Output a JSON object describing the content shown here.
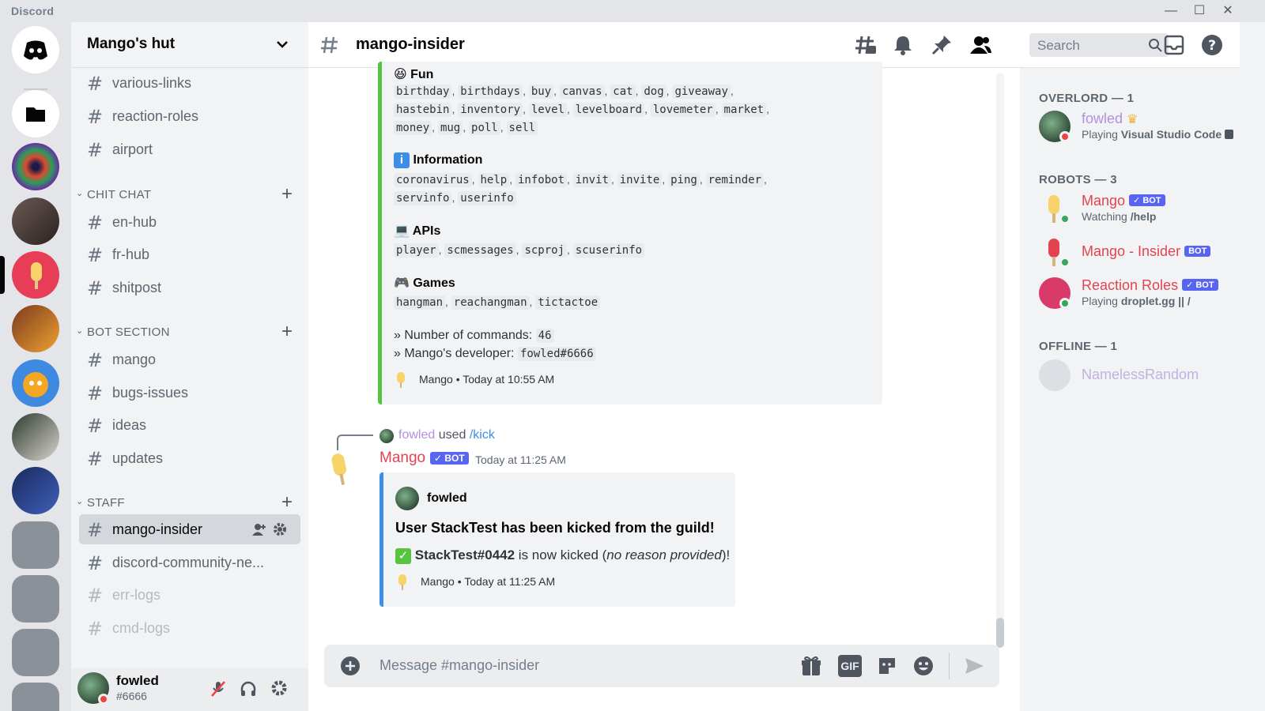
{
  "window": {
    "brand": "Discord"
  },
  "server": {
    "name": "Mango's hut"
  },
  "channels_top": [
    {
      "label": "various-links"
    },
    {
      "label": "reaction-roles"
    },
    {
      "label": "airport"
    }
  ],
  "categories": {
    "chit_chat": {
      "label": "CHIT CHAT",
      "channels": [
        {
          "label": "en-hub"
        },
        {
          "label": "fr-hub"
        },
        {
          "label": "shitpost"
        }
      ]
    },
    "bot_section": {
      "label": "BOT SECTION",
      "channels": [
        {
          "label": "mango"
        },
        {
          "label": "bugs-issues"
        },
        {
          "label": "ideas"
        },
        {
          "label": "updates"
        }
      ]
    },
    "staff": {
      "label": "STAFF",
      "channels": [
        {
          "label": "mango-insider"
        },
        {
          "label": "discord-community-ne..."
        },
        {
          "label": "err-logs"
        },
        {
          "label": "cmd-logs"
        }
      ]
    }
  },
  "user": {
    "name": "fowled",
    "tag": "#6666"
  },
  "chat": {
    "channel": "mango-insider",
    "search_placeholder": "Search",
    "composer_placeholder": "Message #mango-insider",
    "gif_label": "GIF"
  },
  "help_embed": {
    "sections": [
      {
        "title": "Fun",
        "commands": [
          "birthday",
          "birthdays",
          "buy",
          "canvas",
          "cat",
          "dog",
          "giveaway",
          "hastebin",
          "inventory",
          "level",
          "levelboard",
          "lovemeter",
          "market",
          "money",
          "mug",
          "poll",
          "sell"
        ]
      },
      {
        "title": "Information",
        "commands": [
          "coronavirus",
          "help",
          "infobot",
          "invit",
          "invite",
          "ping",
          "reminder",
          "servinfo",
          "userinfo"
        ]
      },
      {
        "title": "APIs",
        "commands": [
          "player",
          "scmessages",
          "scproj",
          "scuserinfo"
        ]
      },
      {
        "title": "Games",
        "commands": [
          "hangman",
          "reachangman",
          "tictactoe"
        ]
      }
    ],
    "count_label": "» Number of commands:",
    "count_value": "46",
    "dev_label": "» Mango's developer:",
    "dev_value": "fowled#6666",
    "footer": "Mango • Today at 10:55 AM"
  },
  "kick_message": {
    "reply_user": "fowled",
    "reply_used": "used",
    "reply_command": "/kick",
    "author": "Mango",
    "bot_badge": "✓ BOT",
    "timestamp": "Today at 11:25 AM",
    "embed_author": "fowled",
    "embed_title": "User StackTest has been kicked from the guild!",
    "embed_user": "StackTest#0442",
    "embed_text_mid": " is now kicked (",
    "embed_reason": "no reason provided",
    "embed_text_end": ")!",
    "embed_footer": "Mango • Today at 11:25 AM"
  },
  "members": {
    "overlord": {
      "label": "OVERLORD — 1",
      "name": "fowled",
      "status_prefix": "Playing ",
      "status_bold": "Visual Studio Code"
    },
    "robots": {
      "label": "ROBOTS — 3",
      "items": [
        {
          "name": "Mango",
          "badge": "✓ BOT",
          "status_prefix": "Watching ",
          "status_bold": "/help"
        },
        {
          "name": "Mango - Insider",
          "badge": "BOT",
          "status_prefix": "",
          "status_bold": ""
        },
        {
          "name": "Reaction Roles",
          "badge": "✓ BOT",
          "status_prefix": "Playing ",
          "status_bold": "droplet.gg || /"
        }
      ]
    },
    "offline": {
      "label": "OFFLINE — 1",
      "name": "NamelessRandom"
    }
  },
  "colors": {
    "bot_red": "#e2434f",
    "blurple": "#5865f2",
    "embed_green": "#57c43f",
    "embed_blue": "#3b8fe8",
    "fowled_purple": "#b48fe0",
    "online": "#3ba55d",
    "dnd": "#ed4245"
  }
}
